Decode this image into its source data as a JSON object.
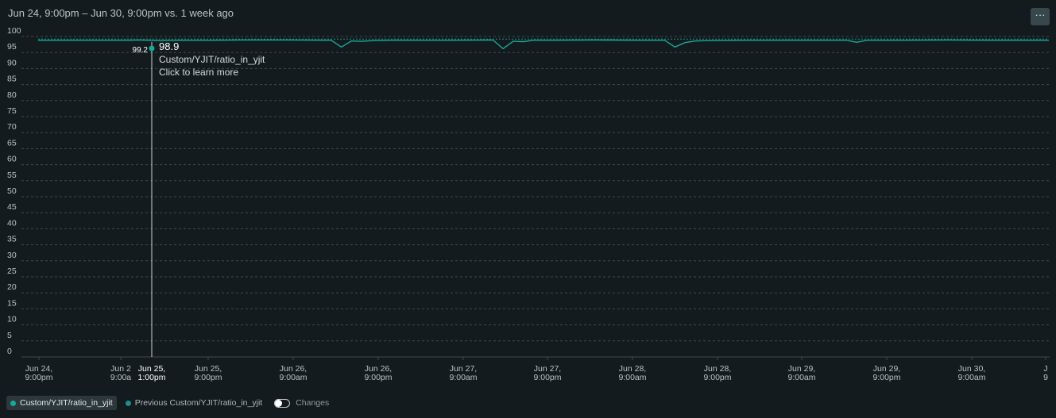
{
  "header": {
    "title": "Jun 24, 9:00pm – Jun 30, 9:00pm vs. 1 week ago",
    "more_label": "···"
  },
  "tooltip": {
    "value": "98.9",
    "series": "Custom/YJIT/ratio_in_yjit",
    "hint": "Click to learn more",
    "previous_value": "99.2",
    "x_label_line1": "Jun 25,",
    "x_label_line2": "1:00pm"
  },
  "legend": {
    "current_label": "Custom/YJIT/ratio_in_yjit",
    "previous_label": "Previous Custom/YJIT/ratio_in_yjit",
    "changes_label": "Changes"
  },
  "colors": {
    "current": "#17a99b",
    "previous": "#1d8f86",
    "grid": "#3f4a4e",
    "text": "#b8c2c4"
  },
  "chart_data": {
    "type": "line",
    "title": "",
    "xlabel": "",
    "ylabel": "",
    "ylim": [
      0,
      100
    ],
    "yticks": [
      0,
      5,
      10,
      15,
      20,
      25,
      30,
      35,
      40,
      45,
      50,
      55,
      60,
      65,
      70,
      75,
      80,
      85,
      90,
      95,
      100
    ],
    "grid": true,
    "xticks": [
      [
        "Jun 24,",
        "9:00pm"
      ],
      [
        "Jun 2",
        "9:00a"
      ],
      [
        "Jun 25,",
        "9:00pm"
      ],
      [
        "Jun 26,",
        "9:00am"
      ],
      [
        "Jun 26,",
        "9:00pm"
      ],
      [
        "Jun 27,",
        "9:00am"
      ],
      [
        "Jun 27,",
        "9:00pm"
      ],
      [
        "Jun 28,",
        "9:00am"
      ],
      [
        "Jun 28,",
        "9:00pm"
      ],
      [
        "Jun 29,",
        "9:00am"
      ],
      [
        "Jun 29,",
        "9:00pm"
      ],
      [
        "Jun 30,",
        "9:00am"
      ],
      [
        "J",
        "9"
      ]
    ],
    "series": [
      {
        "name": "Custom/YJIT/ratio_in_yjit",
        "x": [
          0,
          0.05,
          0.09,
          0.1,
          0.12,
          0.14,
          0.17,
          0.2,
          0.25,
          0.29,
          0.3,
          0.31,
          0.32,
          0.33,
          0.35,
          0.4,
          0.45,
          0.46,
          0.47,
          0.48,
          0.49,
          0.5,
          0.55,
          0.6,
          0.62,
          0.63,
          0.64,
          0.65,
          0.66,
          0.7,
          0.8,
          0.81,
          0.82,
          0.85,
          0.9,
          0.95,
          1.0
        ],
        "values": [
          98.8,
          98.8,
          98.8,
          98.9,
          98.7,
          98.8,
          98.8,
          98.9,
          98.9,
          98.8,
          96.7,
          98.6,
          98.5,
          98.7,
          98.8,
          98.8,
          98.9,
          96.2,
          98.5,
          98.4,
          98.8,
          98.8,
          98.9,
          98.8,
          98.8,
          96.7,
          98.1,
          98.6,
          98.7,
          98.8,
          98.8,
          98.2,
          98.8,
          98.8,
          98.9,
          98.8,
          98.8
        ]
      },
      {
        "name": "Previous Custom/YJIT/ratio_in_yjit",
        "x": [
          0,
          0.25,
          0.5,
          0.75,
          1.0
        ],
        "values": [
          99.2,
          99.2,
          99.2,
          99.2,
          99.2
        ]
      }
    ]
  }
}
